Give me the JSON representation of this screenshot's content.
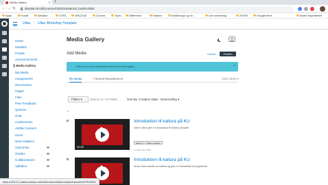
{
  "browser": {
    "tab_title": "Media Gallery",
    "url": "absalon.ku.dk/courses/18322/external_tools/14563",
    "bookmarks": [
      "Apps",
      "Kunet",
      "Absalon",
      "CORL",
      "OBL2018",
      "Corona",
      "Tools",
      "Difference",
      "Kaltura",
      "Workshops og se...",
      "Live streaming",
      "ZOOM",
      "Google drive",
      "Andre bogmærker"
    ],
    "status_url": "https://2013-1.kaltura.kenku.net/edit/content/index/ands/channelId/27522502"
  },
  "breadcrumb": {
    "course": "Ullas",
    "page": "Ullas Workshop Template"
  },
  "course_nav": [
    {
      "label": "Home",
      "active": false,
      "eye": false
    },
    {
      "label": "Modules",
      "active": false,
      "eye": false
    },
    {
      "label": "People",
      "active": false,
      "eye": false
    },
    {
      "label": "Announcements",
      "active": false,
      "eye": false
    },
    {
      "label": "Media Gallery",
      "active": true,
      "eye": false
    },
    {
      "label": "My Media",
      "active": false,
      "eye": false
    },
    {
      "label": "Assignments",
      "active": false,
      "eye": false
    },
    {
      "label": "Discussions",
      "active": false,
      "eye": false
    },
    {
      "label": "Pages",
      "active": false,
      "eye": false
    },
    {
      "label": "Files",
      "active": false,
      "eye": false
    },
    {
      "label": "Peer Feedback",
      "active": false,
      "eye": false
    },
    {
      "label": "Quizzes",
      "active": false,
      "eye": false
    },
    {
      "label": "Chat",
      "active": false,
      "eye": false
    },
    {
      "label": "Conferences",
      "active": false,
      "eye": false
    },
    {
      "label": "Adobe Connect",
      "active": false,
      "eye": false
    },
    {
      "label": "Zoom",
      "active": false,
      "eye": false
    },
    {
      "label": "New Analytics",
      "active": false,
      "eye": false
    },
    {
      "label": "Outcomes",
      "active": false,
      "eye": true
    },
    {
      "label": "Grades",
      "active": false,
      "eye": true
    },
    {
      "label": "Collaborations",
      "active": false,
      "eye": true
    },
    {
      "label": "Syllabus",
      "active": false,
      "eye": true
    }
  ],
  "main": {
    "title": "Media Gallery",
    "subtitle": "Add Media",
    "cancel_label": "Cancel",
    "publish_label": "Publish",
    "alert_text": "Select one or more media items to add to the current gallery",
    "alert_close": "×",
    "tabs": [
      "My Media",
      "7 Shared Repositories"
    ],
    "add_new": "ADD NEW",
    "filters_label": "Filters",
    "search_placeholder": "Search In: All Fields",
    "sort_label": "Sort By: Creation Date - Descending",
    "count": "10"
  },
  "media_items": [
    {
      "title": "Introduktion til kaltura på KU",
      "description": "Denne video giver en introduktion til Kaltura i Absalon",
      "tags": [
        "kaltura",
        "kaltura capture"
      ],
      "date": "on May 29th, 2020",
      "duration": "00:56"
    },
    {
      "title": "Introduktion til kaltura på KU",
      "description": "denne video handler om Kaltura og giver en introduktion til programmet",
      "tags": [],
      "date": "",
      "duration": ""
    }
  ]
}
